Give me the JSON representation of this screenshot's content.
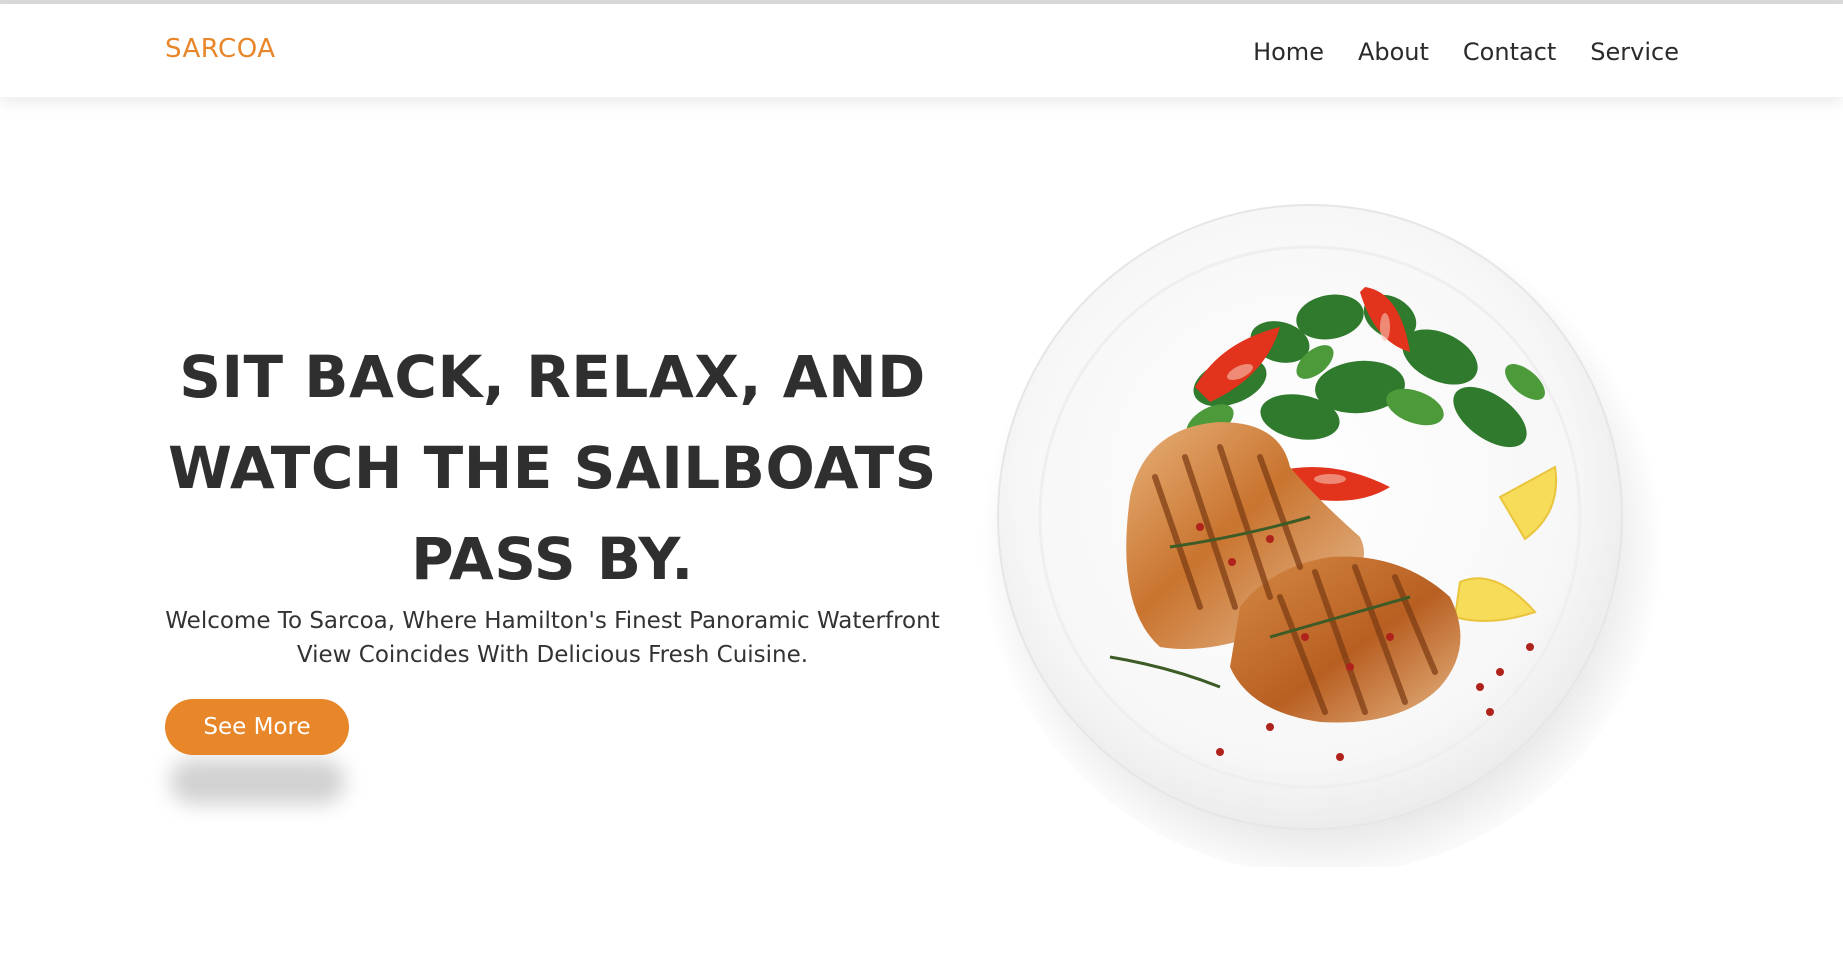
{
  "nav": {
    "brand": "SARCOA",
    "links": [
      "Home",
      "About",
      "Contact",
      "Service"
    ]
  },
  "hero": {
    "headline_line1": "SIT BACK, RELAX, AND",
    "headline_line2": "WATCH THE SAILBOATS",
    "headline_line3": "PASS BY.",
    "subtext_line1": "Welcome To Sarcoa, Where Hamilton's Finest Panoramic Waterfront",
    "subtext_line2": "View Coincides With Delicious Fresh Cuisine.",
    "cta_label": "See More",
    "image_subject": "grilled-chicken-salad-plate"
  },
  "colors": {
    "accent": "#e8862a",
    "text": "#2f2f2f",
    "background": "#ffffff"
  }
}
